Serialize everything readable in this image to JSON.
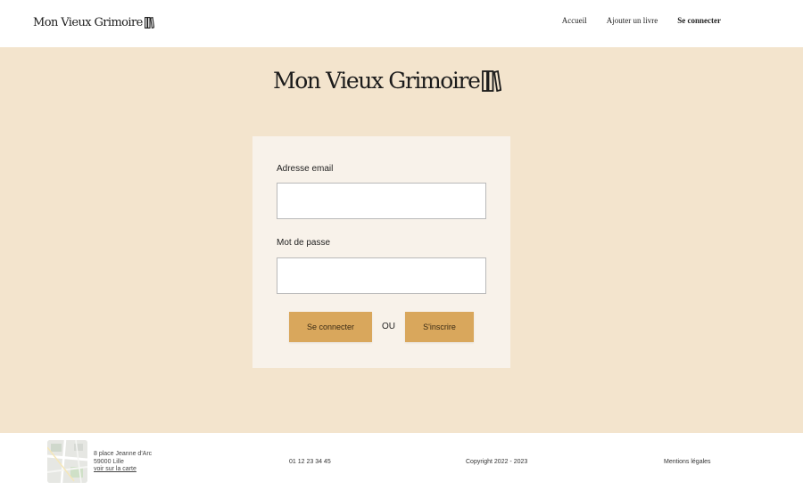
{
  "header": {
    "brand": "Mon Vieux Grimoire",
    "nav": {
      "home": "Accueil",
      "add_book": "Ajouter un livre",
      "login": "Se connecter"
    }
  },
  "main": {
    "brand": "Mon Vieux Grimoire",
    "form": {
      "email_label": "Adresse email",
      "email_value": "",
      "password_label": "Mot de passe",
      "password_value": "",
      "login_button": "Se connecter",
      "separator": "OU",
      "signup_button": "S'inscrire"
    }
  },
  "footer": {
    "address_line1": "8 place Jeanne d'Arc",
    "address_line2": "59000 Lille",
    "map_link": "voir sur la carte",
    "phone": "01 12 23 34 45",
    "copyright": "Copyright 2022 - 2023",
    "legal": "Mentions légales"
  },
  "colors": {
    "main_background": "#f3e4cd",
    "card_background": "#f8f2ea",
    "button": "#d9a75c",
    "header_footer_background": "#ffffff"
  },
  "icons": {
    "logo_mark": "books-icon",
    "map_thumbnail": "map-icon"
  }
}
